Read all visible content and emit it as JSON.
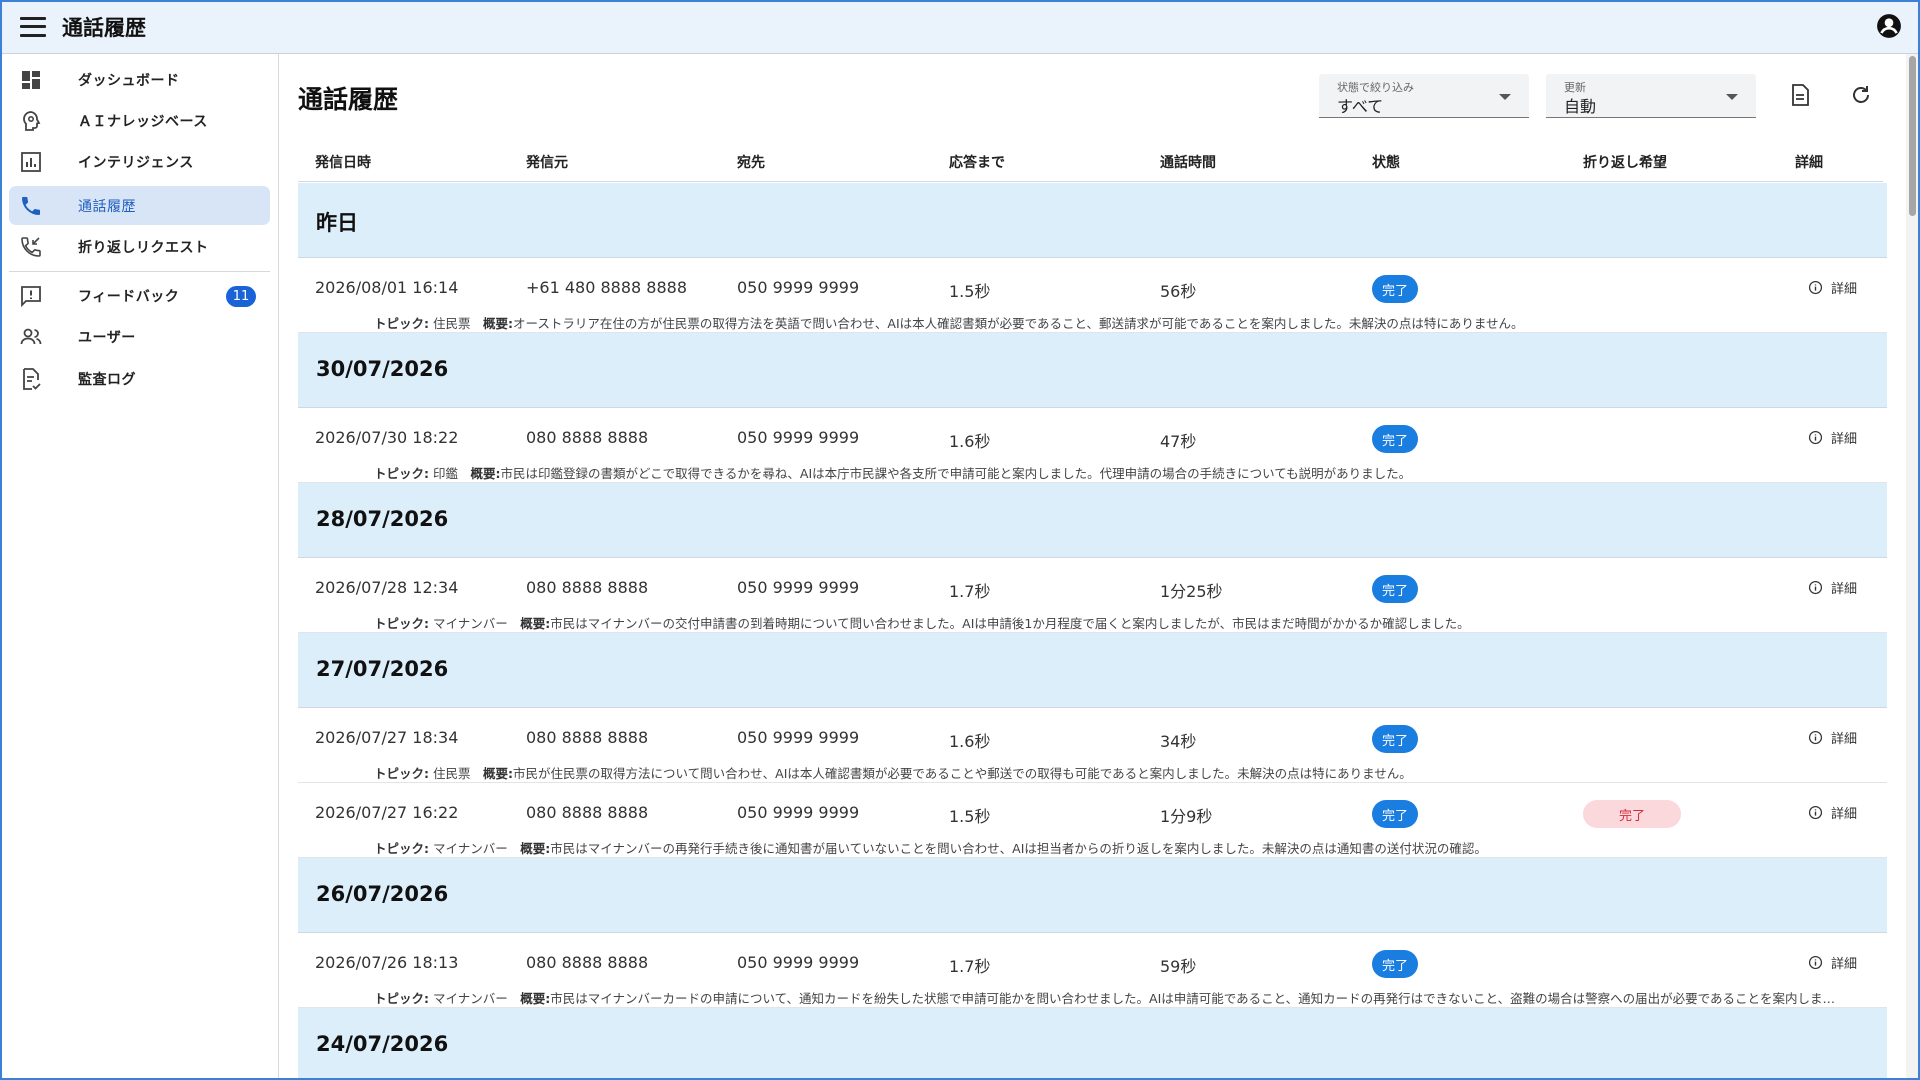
{
  "app": {
    "title": "通話履歴"
  },
  "sidebar": {
    "items": [
      {
        "label": "ダッシュボード"
      },
      {
        "label": "ＡＩナレッジベース"
      },
      {
        "label": "インテリジェンス"
      },
      {
        "label": "通話履歴"
      },
      {
        "label": "折り返しリクエスト"
      },
      {
        "label": "フィードバック",
        "badge": "11"
      },
      {
        "label": "ユーザー"
      },
      {
        "label": "監査ログ"
      }
    ]
  },
  "main": {
    "title": "通話履歴",
    "status_filter": {
      "label": "状態で絞り込み",
      "value": "すべて"
    },
    "refresh_filter": {
      "label": "更新",
      "value": "自動"
    },
    "columns": [
      "発信日時",
      "発信元",
      "宛先",
      "応答まで",
      "通話時間",
      "状態",
      "折り返し希望",
      "詳細"
    ],
    "topic_label": "トピック:",
    "summary_label": "概要:",
    "detail_label": "詳細",
    "groups": [
      {
        "date": "昨日",
        "rows": [
          {
            "datetime": "2026/08/01 16:14",
            "from": "+61 480 8888 8888",
            "to": "050 9999 9999",
            "answer": "1.5秒",
            "duration": "56秒",
            "status": "完了",
            "callback": "",
            "topic": "住民票",
            "summary": "オーストラリア在住の方が住民票の取得方法を英語で問い合わせ、AIは本人確認書類が必要であること、郵送請求が可能であることを案内しました。未解決の点は特にありません。"
          }
        ]
      },
      {
        "date": "30/07/2026",
        "rows": [
          {
            "datetime": "2026/07/30 18:22",
            "from": "080 8888 8888",
            "to": "050 9999 9999",
            "answer": "1.6秒",
            "duration": "47秒",
            "status": "完了",
            "callback": "",
            "topic": "印鑑",
            "summary": "市民は印鑑登録の書類がどこで取得できるかを尋ね、AIは本庁市民課や各支所で申請可能と案内しました。代理申請の場合の手続きについても説明がありました。"
          }
        ]
      },
      {
        "date": "28/07/2026",
        "rows": [
          {
            "datetime": "2026/07/28 12:34",
            "from": "080 8888 8888",
            "to": "050 9999 9999",
            "answer": "1.7秒",
            "duration": "1分25秒",
            "status": "完了",
            "callback": "",
            "topic": "マイナンバー",
            "summary": "市民はマイナンバーの交付申請書の到着時期について問い合わせました。AIは申請後1か月程度で届くと案内しましたが、市民はまだ時間がかかるか確認しました。"
          }
        ]
      },
      {
        "date": "27/07/2026",
        "rows": [
          {
            "datetime": "2026/07/27 18:34",
            "from": "080 8888 8888",
            "to": "050 9999 9999",
            "answer": "1.6秒",
            "duration": "34秒",
            "status": "完了",
            "callback": "",
            "topic": "住民票",
            "summary": "市民が住民票の取得方法について問い合わせ、AIは本人確認書類が必要であることや郵送での取得も可能であると案内しました。未解決の点は特にありません。"
          },
          {
            "datetime": "2026/07/27 16:22",
            "from": "080 8888 8888",
            "to": "050 9999 9999",
            "answer": "1.5秒",
            "duration": "1分9秒",
            "status": "完了",
            "callback": "完了",
            "topic": "マイナンバー",
            "summary": "市民はマイナンバーの再発行手続き後に通知書が届いていないことを問い合わせ、AIは担当者からの折り返しを案内しました。未解決の点は通知書の送付状況の確認。"
          }
        ]
      },
      {
        "date": "26/07/2026",
        "rows": [
          {
            "datetime": "2026/07/26 18:13",
            "from": "080 8888 8888",
            "to": "050 9999 9999",
            "answer": "1.7秒",
            "duration": "59秒",
            "status": "完了",
            "callback": "",
            "topic": "マイナンバー",
            "summary": "市民はマイナンバーカードの申請について、通知カードを紛失した状態で申請可能かを問い合わせました。AIは申請可能であること、通知カードの再発行はできないこと、盗難の場合は警察への届出が必要であることを案内しました。"
          }
        ]
      },
      {
        "date": "24/07/2026",
        "rows": []
      }
    ]
  },
  "colors": {
    "accent": "#1a63d6",
    "status_chip": "#1a7de0",
    "callback_chip_bg": "#fbd8dc",
    "callback_chip_text": "#d32b3a",
    "group_bg": "#ddeefb",
    "appbar_bg": "#eaf2fb",
    "active_nav_bg": "#d7e5f7"
  }
}
